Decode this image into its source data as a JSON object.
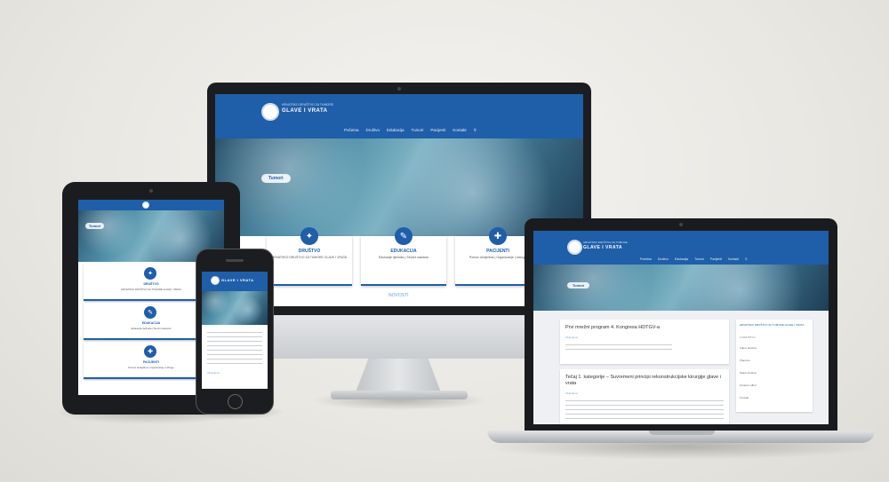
{
  "brand": {
    "name": "GLAVE I VRATA",
    "subtitle": "HRVATSKO DRUŠTVO ZA TUMORE"
  },
  "nav": {
    "items": [
      "Početna",
      "Društvo",
      "Edukacija",
      "Tumori",
      "Pacijenti",
      "Kontakt"
    ]
  },
  "hero": {
    "tag": "Tumori"
  },
  "cards": [
    {
      "title": "DRUŠTVO",
      "text": "HRVATSKO DRUŠTVO ZA TUMORE GLAVE I VRATA"
    },
    {
      "title": "EDUKACIJA",
      "text": "Edukacije liječnika | Stručni sastanci"
    },
    {
      "title": "PACIJENTI",
      "text": "Pomoć oboljelima | Organizacije | Udruge"
    }
  ],
  "sections": {
    "news": "NOVOSTI"
  },
  "laptop": {
    "posts": [
      {
        "title": "Prvi mrežni program 4. Kongresa HDTGV-a",
        "meta": "Objavljeno"
      },
      {
        "title": "Tečaj 1. kategorije – Suvremeni principi rekonstrukcijske kirurgije glave i vrata",
        "meta": "Objavljeno"
      }
    ],
    "sidebar": {
      "heading": "HRVATSKO DRUŠTVO ZA TUMORE GLAVE I VRATA",
      "sub": "O DRUŠTVU",
      "lines": [
        "Ciljevi društva",
        "Članstvo",
        "Statut društva",
        "Upravni odbor",
        "Kontakt"
      ]
    }
  },
  "colors": {
    "brand": "#1f5ea8",
    "accent": "#6a9fd6"
  }
}
